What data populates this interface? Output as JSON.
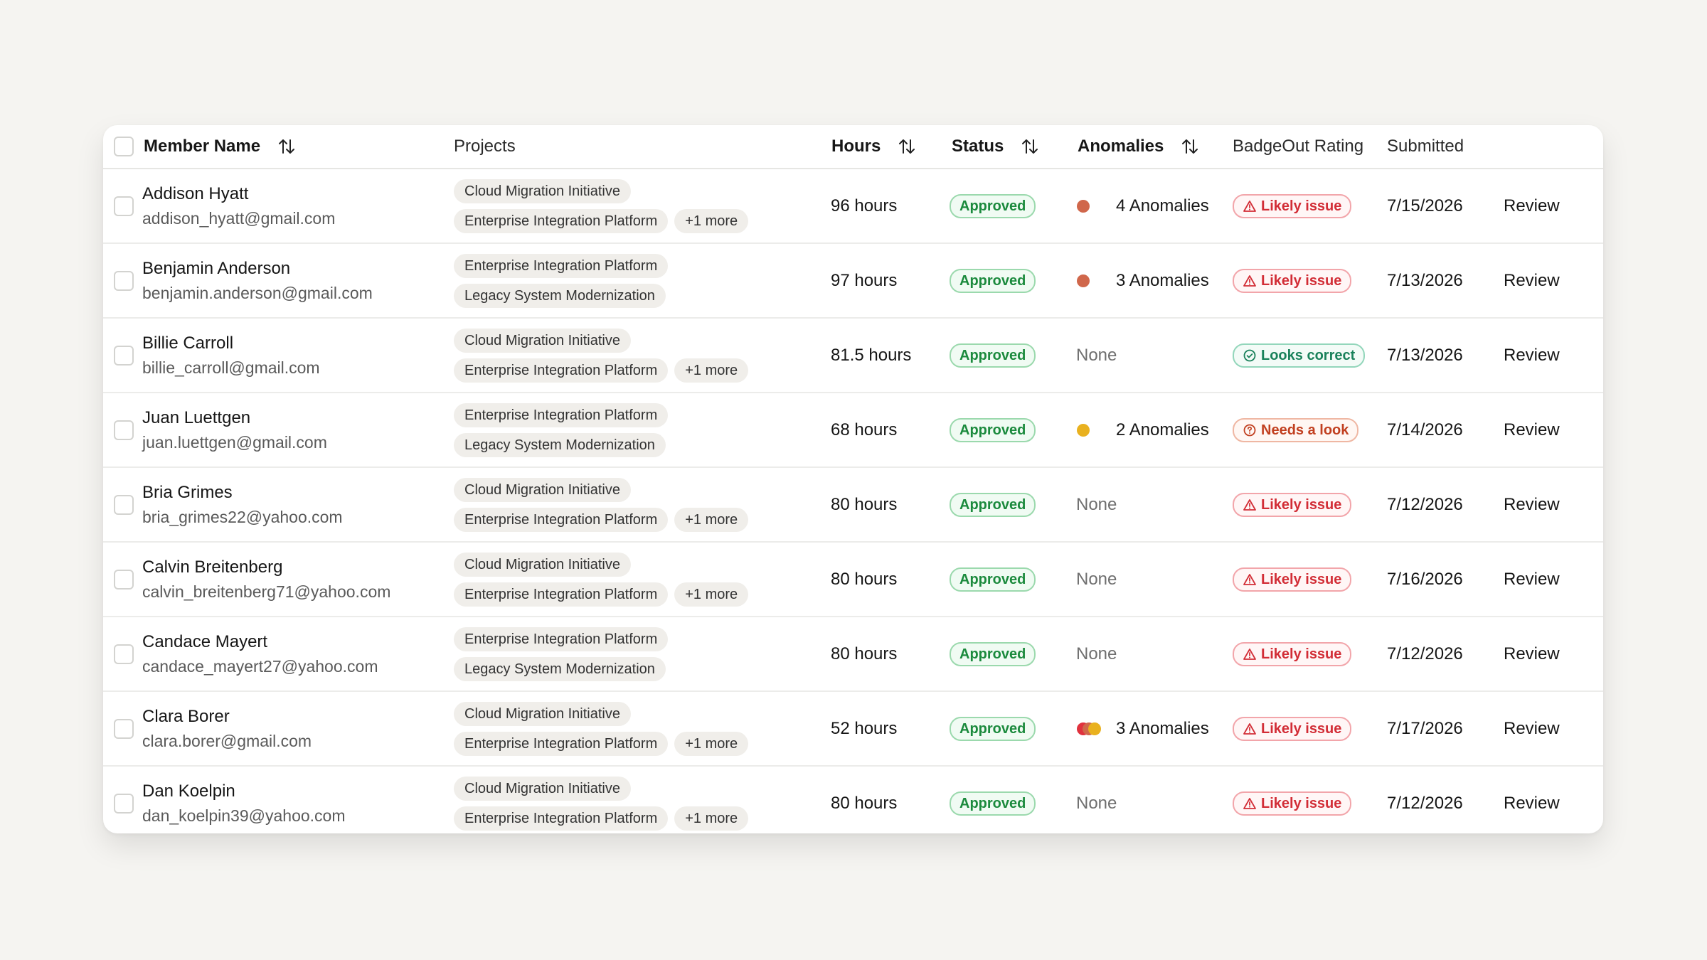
{
  "colors": {
    "approved_green": "#1b8a3d",
    "likely_issue_red": "#d22d36",
    "looks_correct_green": "#19815a",
    "needs_look_orange": "#c13f1f",
    "dot_red": "#d0674b",
    "dot_yellow": "#e9b11f",
    "dot_crimson": "#e0323e"
  },
  "header": {
    "member_name": "Member Name",
    "projects": "Projects",
    "hours": "Hours",
    "status": "Status",
    "anomalies": "Anomalies",
    "rating": "BadgeOut Rating",
    "submitted": "Submitted"
  },
  "rows": [
    {
      "name": "Addison Hyatt",
      "email": "addison_hyatt@gmail.com",
      "project1": "Cloud Migration Initiative",
      "project2": "Enterprise Integration Platform",
      "more": "+1 more",
      "hours": "96 hours",
      "status": "Approved",
      "anomalies": "4 Anomalies",
      "dot": "red",
      "rating": "Likely issue",
      "rating_kind": "issue",
      "submitted": "7/15/2026",
      "action": "Review"
    },
    {
      "name": "Benjamin Anderson",
      "email": "benjamin.anderson@gmail.com",
      "project1": "Enterprise Integration Platform",
      "project2": "Legacy System Modernization",
      "more": "",
      "hours": "97 hours",
      "status": "Approved",
      "anomalies": "3 Anomalies",
      "dot": "red",
      "rating": "Likely issue",
      "rating_kind": "issue",
      "submitted": "7/13/2026",
      "action": "Review"
    },
    {
      "name": "Billie Carroll",
      "email": "billie_carroll@gmail.com",
      "project1": "Cloud Migration Initiative",
      "project2": "Enterprise Integration Platform",
      "more": "+1 more",
      "hours": "81.5 hours",
      "status": "Approved",
      "anomalies": "None",
      "dot": "none",
      "rating": "Looks correct",
      "rating_kind": "correct",
      "submitted": "7/13/2026",
      "action": "Review"
    },
    {
      "name": "Juan Luettgen",
      "email": "juan.luettgen@gmail.com",
      "project1": "Enterprise Integration Platform",
      "project2": "Legacy System Modernization",
      "more": "",
      "hours": "68 hours",
      "status": "Approved",
      "anomalies": "2 Anomalies",
      "dot": "yellow",
      "rating": "Needs a look",
      "rating_kind": "look",
      "submitted": "7/14/2026",
      "action": "Review"
    },
    {
      "name": "Bria Grimes",
      "email": "bria_grimes22@yahoo.com",
      "project1": "Cloud Migration Initiative",
      "project2": "Enterprise Integration Platform",
      "more": "+1 more",
      "hours": "80 hours",
      "status": "Approved",
      "anomalies": "None",
      "dot": "none",
      "rating": "Likely issue",
      "rating_kind": "issue",
      "submitted": "7/12/2026",
      "action": "Review"
    },
    {
      "name": "Calvin Breitenberg",
      "email": "calvin_breitenberg71@yahoo.com",
      "project1": "Cloud Migration Initiative",
      "project2": "Enterprise Integration Platform",
      "more": "+1 more",
      "hours": "80 hours",
      "status": "Approved",
      "anomalies": "None",
      "dot": "none",
      "rating": "Likely issue",
      "rating_kind": "issue",
      "submitted": "7/16/2026",
      "action": "Review"
    },
    {
      "name": "Candace Mayert",
      "email": "candace_mayert27@yahoo.com",
      "project1": "Enterprise Integration Platform",
      "project2": "Legacy System Modernization",
      "more": "",
      "hours": "80 hours",
      "status": "Approved",
      "anomalies": "None",
      "dot": "none",
      "rating": "Likely issue",
      "rating_kind": "issue",
      "submitted": "7/12/2026",
      "action": "Review"
    },
    {
      "name": "Clara Borer",
      "email": "clara.borer@gmail.com",
      "project1": "Cloud Migration Initiative",
      "project2": "Enterprise Integration Platform",
      "more": "+1 more",
      "hours": "52 hours",
      "status": "Approved",
      "anomalies": "3 Anomalies",
      "dot": "multi",
      "rating": "Likely issue",
      "rating_kind": "issue",
      "submitted": "7/17/2026",
      "action": "Review"
    },
    {
      "name": "Dan Koelpin",
      "email": "dan_koelpin39@yahoo.com",
      "project1": "Cloud Migration Initiative",
      "project2": "Enterprise Integration Platform",
      "more": "+1 more",
      "hours": "80 hours",
      "status": "Approved",
      "anomalies": "None",
      "dot": "none",
      "rating": "Likely issue",
      "rating_kind": "issue",
      "submitted": "7/12/2026",
      "action": "Review"
    }
  ]
}
